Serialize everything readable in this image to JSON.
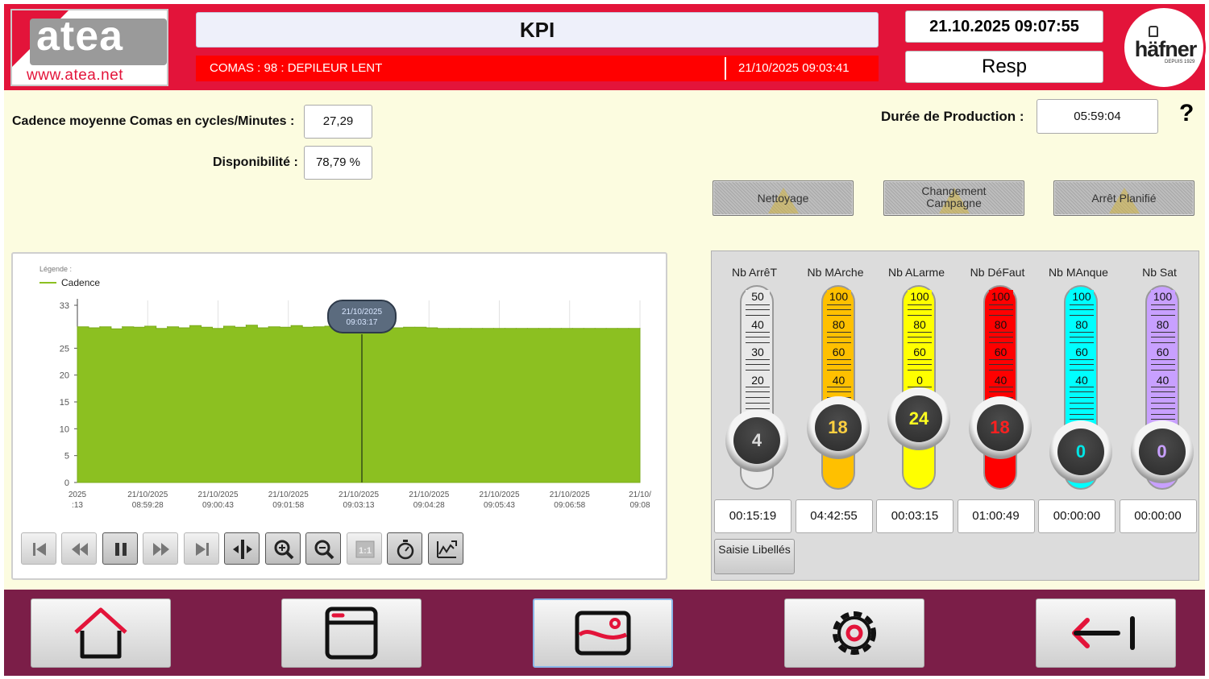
{
  "header": {
    "logo_left": {
      "word": "atea",
      "url": "www.atea.net"
    },
    "title": "KPI",
    "alarm_message": "COMAS : 98 : DEPILEUR LENT",
    "alarm_timestamp": "21/10/2025 09:03:41",
    "datetime": "21.10.2025 09:07:55",
    "user": "Resp",
    "logo_right": {
      "word": "häfner",
      "sub": "DEPUIS 1929"
    },
    "accent_color": "#e3143a",
    "alarm_color": "#ff0000"
  },
  "kpi": {
    "cadence_label": "Cadence moyenne Comas en cycles/Minutes :",
    "cadence_value": "27,29",
    "dispo_label": "Disponibilité :",
    "dispo_value": "78,79 %",
    "duree_label": "Durée de Production :",
    "duree_value": "05:59:04",
    "help": "?"
  },
  "modes": [
    {
      "label": "Nettoyage",
      "icon": "warning-icon"
    },
    {
      "label": "Changement Campagne",
      "icon": "warning-icon"
    },
    {
      "label": "Arrêt Planifié",
      "icon": "warning-icon"
    }
  ],
  "chart_data": {
    "type": "area",
    "legend_title": "Légende :",
    "series": [
      {
        "name": "Cadence",
        "color": "#8cc021"
      }
    ],
    "y_ticks": [
      0,
      5,
      10,
      15,
      20,
      25,
      33
    ],
    "ylim": [
      0,
      33
    ],
    "x_ticks": [
      {
        "date": "2025",
        "time": ":13"
      },
      {
        "date": "21/10/2025",
        "time": "08:59:28"
      },
      {
        "date": "21/10/2025",
        "time": "09:00:43"
      },
      {
        "date": "21/10/2025",
        "time": "09:01:58"
      },
      {
        "date": "21/10/2025",
        "time": "09:03:13"
      },
      {
        "date": "21/10/2025",
        "time": "09:04:28"
      },
      {
        "date": "21/10/2025",
        "time": "09:05:43"
      },
      {
        "date": "21/10/2025",
        "time": "09:06:58"
      },
      {
        "date": "21/10/",
        "time": "09:08"
      }
    ],
    "values": [
      29,
      28.8,
      29,
      28.6,
      29,
      28.9,
      29.1,
      28.7,
      29,
      28.8,
      29.2,
      28.9,
      28.7,
      29.1,
      28.9,
      29.3,
      28.8,
      29,
      28.9,
      29.2,
      28.9,
      29,
      29.1,
      28.8,
      29,
      28.7,
      29,
      28.9,
      28.8,
      28.9,
      28.9,
      28.8,
      28.7,
      28.7,
      28.7,
      28.7,
      28.7,
      28.7,
      28.7,
      28.7,
      28.7,
      28.7,
      28.7,
      28.7,
      28.7,
      28.7,
      28.7,
      28.7,
      28.7,
      28.7,
      28.7
    ],
    "cursor_label": [
      "21/10/2025",
      "09:03:17"
    ],
    "grid": true
  },
  "toolbar": [
    {
      "name": "first-icon"
    },
    {
      "name": "rewind-icon"
    },
    {
      "name": "pause-icon"
    },
    {
      "name": "fast-forward-icon"
    },
    {
      "name": "last-icon"
    },
    {
      "name": "ruler-icon"
    },
    {
      "name": "zoom-in-icon"
    },
    {
      "name": "zoom-out-icon"
    },
    {
      "name": "zoom-reset-icon"
    },
    {
      "name": "timer-icon"
    },
    {
      "name": "trend-icon"
    }
  ],
  "gauges": [
    {
      "title": "Nb ArrêT",
      "value": "4",
      "time": "00:15:19",
      "color": "#e8e8e8",
      "value_color": "#dcdcdc",
      "ticks": [
        "50",
        "40",
        "30",
        "20"
      ],
      "knob_top": 200
    },
    {
      "title": "Nb MArche",
      "value": "18",
      "time": "04:42:55",
      "color": "#ffc000",
      "value_color": "#ffd040",
      "ticks": [
        "100",
        "80",
        "60",
        "40"
      ],
      "knob_top": 184
    },
    {
      "title": "Nb ALarme",
      "value": "24",
      "time": "00:03:15",
      "color": "#ffff00",
      "value_color": "#ffff20",
      "ticks": [
        "100",
        "80",
        "60",
        "0"
      ],
      "knob_top": 173
    },
    {
      "title": "Nb DéFaut",
      "value": "18",
      "time": "01:00:49",
      "color": "#ff0000",
      "value_color": "#ff2020",
      "ticks": [
        "100",
        "80",
        "60",
        "40"
      ],
      "knob_top": 184
    },
    {
      "title": "Nb MAnque",
      "value": "0",
      "time": "00:00:00",
      "color": "#00ffff",
      "value_color": "#00e5e5",
      "ticks": [
        "100",
        "80",
        "60",
        "40"
      ],
      "knob_top": 214
    },
    {
      "title": "Nb Sat",
      "value": "0",
      "time": "00:00:00",
      "color": "#c8a0ff",
      "value_color": "#c8a0ff",
      "ticks": [
        "100",
        "80",
        "60",
        "40"
      ],
      "knob_top": 214
    }
  ],
  "saisie_label": "Saisie Libellés",
  "footer": [
    {
      "name": "home-icon",
      "active": false
    },
    {
      "name": "window-icon",
      "active": false
    },
    {
      "name": "image-icon",
      "active": true
    },
    {
      "name": "settings-icon",
      "active": false
    },
    {
      "name": "logout-icon",
      "active": false
    }
  ]
}
